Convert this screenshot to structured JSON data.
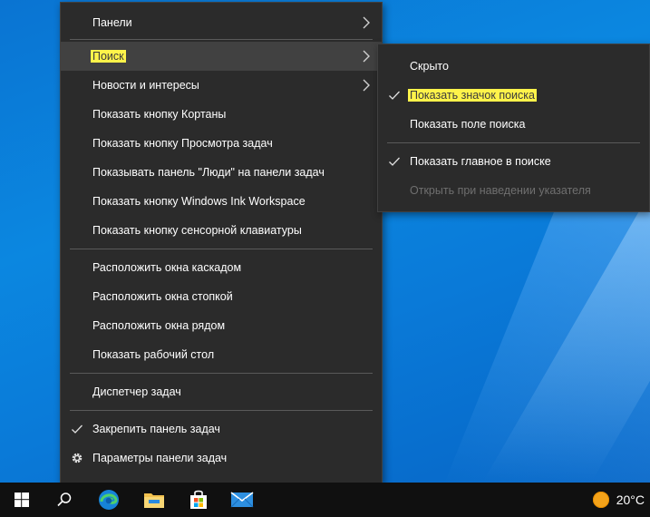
{
  "context_menu": {
    "items": [
      {
        "label": "Панели",
        "submenu": true
      },
      {
        "label": "Поиск",
        "submenu": true,
        "active": true,
        "highlight": true
      },
      {
        "label": "Новости и интересы",
        "submenu": true
      },
      {
        "label": "Показать кнопку Кортаны"
      },
      {
        "label": "Показать кнопку Просмотра задач"
      },
      {
        "label": "Показывать панель \"Люди\" на панели задач"
      },
      {
        "label": "Показать кнопку Windows Ink Workspace"
      },
      {
        "label": "Показать кнопку сенсорной клавиатуры"
      },
      {
        "label": "Расположить окна каскадом"
      },
      {
        "label": "Расположить окна стопкой"
      },
      {
        "label": "Расположить окна рядом"
      },
      {
        "label": "Показать рабочий стол"
      },
      {
        "label": "Диспетчер задач"
      },
      {
        "label": "Закрепить панель задач",
        "checked": true
      },
      {
        "label": "Параметры панели задач",
        "icon": "gear-icon"
      }
    ]
  },
  "search_submenu": {
    "items": [
      {
        "label": "Скрыто"
      },
      {
        "label": "Показать значок поиска",
        "checked": true,
        "highlight": true
      },
      {
        "label": "Показать поле поиска"
      },
      {
        "label": "Показать главное в поиске",
        "checked": true
      },
      {
        "label": "Открыть при наведении указателя",
        "disabled": true
      }
    ]
  },
  "taskbar": {
    "apps": [
      {
        "icon": "windows-start-icon"
      },
      {
        "icon": "search-icon"
      },
      {
        "icon": "edge-icon"
      },
      {
        "icon": "file-explorer-icon"
      },
      {
        "icon": "microsoft-store-icon"
      },
      {
        "icon": "mail-icon"
      }
    ],
    "weather": {
      "icon": "sun-icon",
      "temperature": "20°C"
    }
  },
  "colors": {
    "menu_bg": "#2b2b2b",
    "menu_hover": "#414141",
    "highlight": "#fff34a",
    "taskbar_bg": "#101010",
    "desktop_blue": "#0a78d7"
  }
}
